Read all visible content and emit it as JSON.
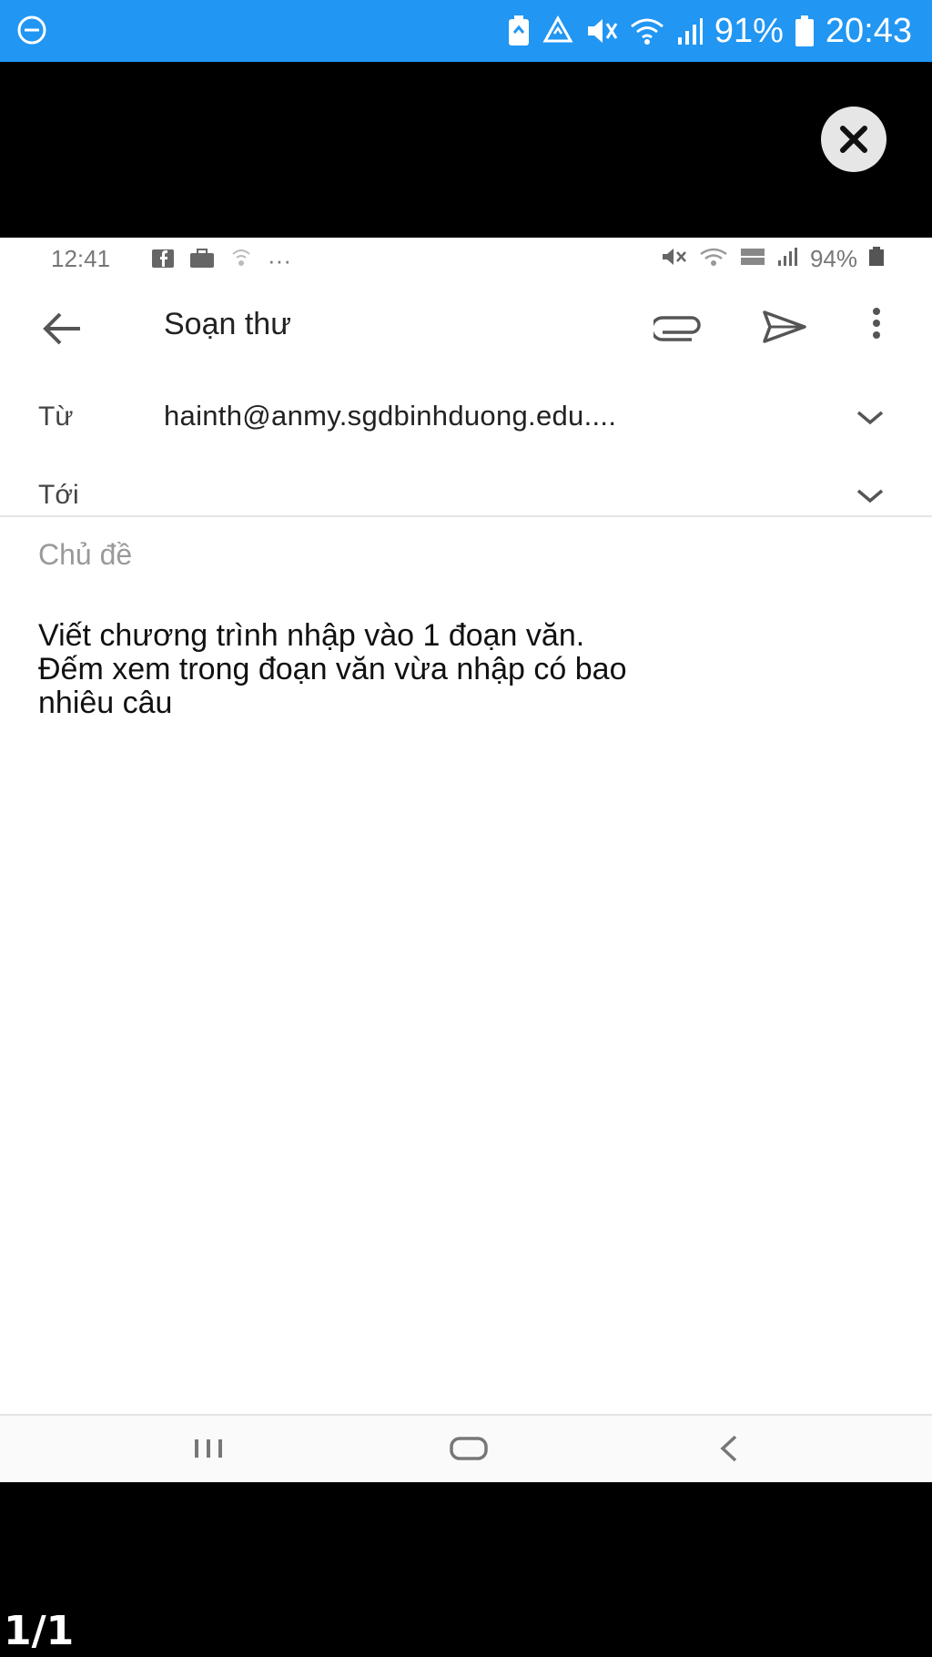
{
  "outer_status": {
    "battery": "91%",
    "time": "20:43",
    "icons": [
      "do-not-disturb-icon",
      "battery-saver-icon",
      "recycle-icon",
      "mute-icon",
      "wifi-icon",
      "signal-icon",
      "battery-icon"
    ]
  },
  "viewer": {
    "close_icon": "close-icon",
    "pager": "1/1"
  },
  "inner_status": {
    "time": "12:41",
    "overflow": "···",
    "battery": "94%"
  },
  "compose": {
    "title": "Soạn thư",
    "from_label": "Từ",
    "from_value": "hainth@anmy.sgdbinhduong.edu....",
    "to_label": "Tới",
    "subject_placeholder": "Chủ đề",
    "body_lines": [
      "Viết chương trình nhập vào 1 đoạn văn.",
      "Đếm xem trong đoạn văn vừa nhập có bao",
      "nhiêu câu"
    ]
  },
  "colors": {
    "status_bar": "#2196f3",
    "background": "#000000",
    "sheet": "#ffffff"
  }
}
